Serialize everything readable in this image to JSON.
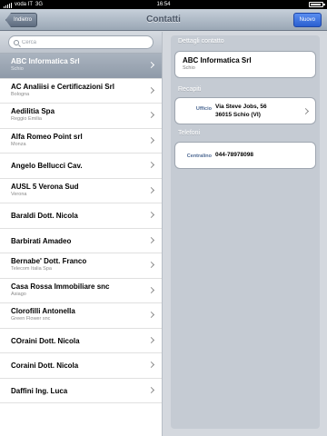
{
  "status_bar": {
    "carrier": "voda IT",
    "network": "3G",
    "time": "16:54"
  },
  "nav": {
    "back_label": "Indietro",
    "title": "Contatti",
    "new_label": "Nuovo"
  },
  "search": {
    "placeholder": "Cerca"
  },
  "contacts": [
    {
      "name": "ABC Informatica Srl",
      "city": "Schio",
      "selected": true
    },
    {
      "name": "AC Analiisi e Certificazioni Srl",
      "city": "Bologna"
    },
    {
      "name": "Aedilitia Spa",
      "city": "Reggio Emilia"
    },
    {
      "name": "Alfa Romeo Point srl",
      "city": "Monza"
    },
    {
      "name": "Angelo Bellucci Cav.",
      "city": ""
    },
    {
      "name": "AUSL 5 Verona Sud",
      "city": "Verona"
    },
    {
      "name": "Baraldi Dott. Nicola",
      "city": ""
    },
    {
      "name": "Barbirati  Amadeo",
      "city": ""
    },
    {
      "name": "Bernabe' Dott. Franco",
      "city": "Telecom Italia Spa"
    },
    {
      "name": "Casa Rossa Immobiliare snc",
      "city": "Asiago"
    },
    {
      "name": "Clorofilli  Antonella",
      "city": "Green Flower snc"
    },
    {
      "name": "COraini Dott. Nicola",
      "city": ""
    },
    {
      "name": "Coraini Dott. Nicola",
      "city": ""
    },
    {
      "name": "Daffini Ing. Luca",
      "city": ""
    }
  ],
  "detail": {
    "section_title": "Dettagli contatto",
    "name": "ABC Informatica Srl",
    "city": "Schio",
    "addresses_title": "Recapiti",
    "address_label": "Ufficio",
    "address_line1": "Via Steve Jobs, 56",
    "address_line2": "36015 Schio (VI)",
    "phones_title": "Telefoni",
    "phone_label": "Centralino",
    "phone_value": "044-78978098"
  },
  "colors": {
    "accent": "#2a5fd0",
    "selected_row": "#9aa4b1"
  }
}
